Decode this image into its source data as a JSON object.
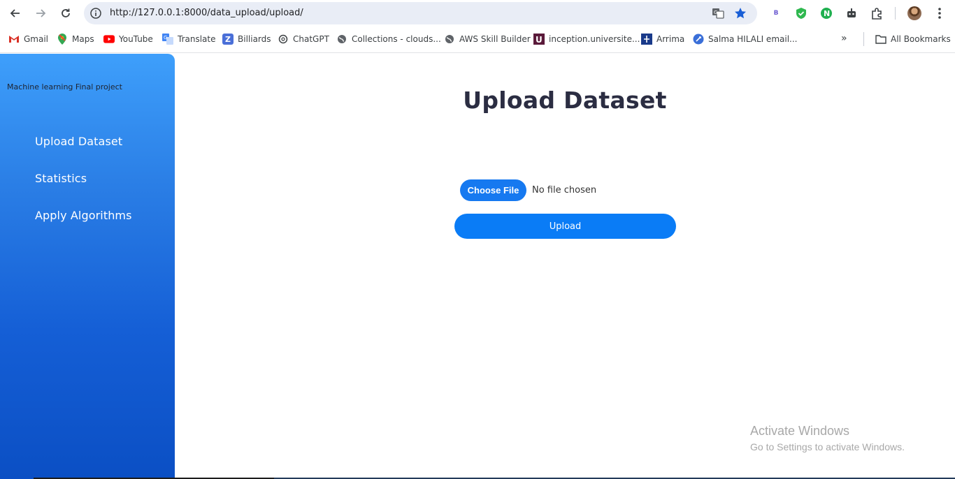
{
  "browser": {
    "url": "http://127.0.0.1:8000/data_upload/upload/",
    "bing_badge": "B"
  },
  "bookmarks": [
    {
      "label": "Gmail",
      "icon": "gmail-icon"
    },
    {
      "label": "Maps",
      "icon": "maps-icon"
    },
    {
      "label": "YouTube",
      "icon": "youtube-icon"
    },
    {
      "label": "Translate",
      "icon": "translate-icon"
    },
    {
      "label": "Billiards",
      "icon": "billiards-icon"
    },
    {
      "label": "ChatGPT",
      "icon": "chatgpt-icon"
    },
    {
      "label": "Collections - clouds...",
      "icon": "globe-icon"
    },
    {
      "label": "AWS Skill Builder",
      "icon": "globe-icon"
    },
    {
      "label": "inception.universite...",
      "icon": "inception-icon"
    },
    {
      "label": "Arrima",
      "icon": "arrima-icon"
    },
    {
      "label": "Salma HILALI email...",
      "icon": "rocket-icon"
    }
  ],
  "all_bookmarks": "All Bookmarks",
  "sidebar": {
    "title": "Machine learning Final project",
    "items": [
      {
        "label": "Upload Dataset"
      },
      {
        "label": "Statistics"
      },
      {
        "label": "Apply Algorithms"
      }
    ]
  },
  "main": {
    "title": "Upload Dataset",
    "choose_file": "Choose File",
    "file_status": "No file chosen",
    "upload": "Upload"
  },
  "watermark": {
    "line1": "Activate Windows",
    "line2": "Go to Settings to activate Windows."
  },
  "colors": {
    "accent": "#0a7cf6",
    "sidebar_top": "#3e9ffb",
    "sidebar_bottom": "#0b4fc4",
    "title": "#2b2d42"
  }
}
